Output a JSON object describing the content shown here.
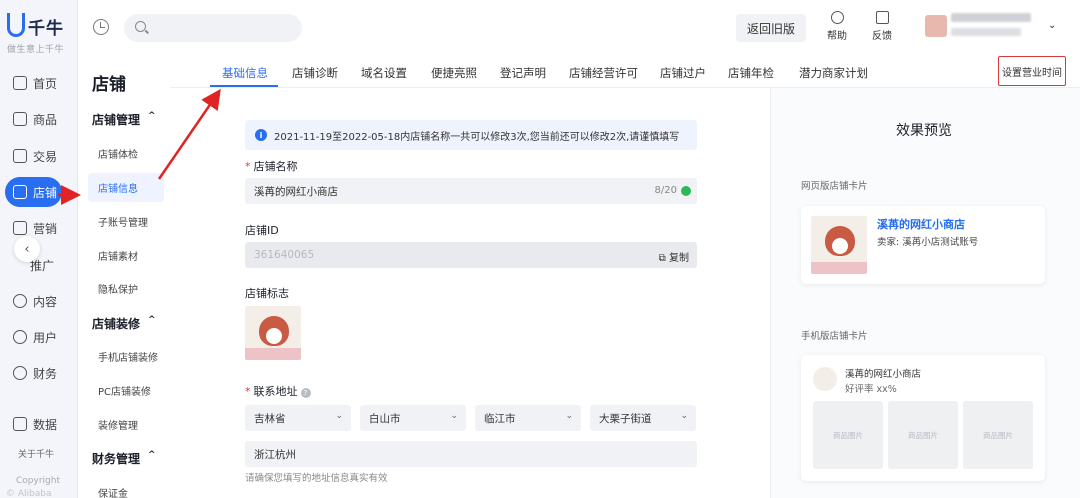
{
  "brand": {
    "name": "千牛",
    "tagline": "做生意上千牛"
  },
  "rail": {
    "items": [
      "首页",
      "商品",
      "交易",
      "店铺",
      "营销",
      "推广",
      "内容",
      "用户",
      "财务",
      "数据"
    ],
    "about": "关于千牛",
    "copyright": "Copyright",
    "copyright2": "© Alibaba Group"
  },
  "topbar": {
    "search_placeholder": "",
    "old_version": "返回旧版",
    "help": "帮助",
    "feedback": "反馈"
  },
  "sub": {
    "title": "店铺",
    "groups": [
      {
        "label": "店铺管理",
        "items": [
          "店铺体检",
          "店铺信息",
          "子账号管理",
          "店铺素材",
          "隐私保护"
        ]
      },
      {
        "label": "店铺装修",
        "items": [
          "手机店铺装修",
          "PC店铺装修",
          "装修管理"
        ]
      },
      {
        "label": "财务管理",
        "items": [
          "保证金"
        ]
      }
    ]
  },
  "tabs": [
    "基础信息",
    "店铺诊断",
    "域名设置",
    "便捷亮照",
    "登记声明",
    "店铺经营许可",
    "店铺过户",
    "店铺年检",
    "潜力商家计划"
  ],
  "hours_button": "设置营业时间",
  "notice": "2021-11-19至2022-05-18内店铺名称一共可以修改3次,您当前还可以修改2次,请谨慎填写",
  "form": {
    "name_label": "店铺名称",
    "name_value": "溪苒的网红小商店",
    "name_count": "8/20",
    "id_label": "店铺ID",
    "id_value": "361640065",
    "copy": "复制",
    "logo_label": "店铺标志",
    "address_label": "联系地址",
    "province": "吉林省",
    "city": "白山市",
    "district": "临江市",
    "street": "大栗子街道",
    "address_detail": "浙江杭州",
    "hint": "请确保您填写的地址信息真实有效"
  },
  "preview": {
    "title": "效果预览",
    "pc_label": "网页版店铺卡片",
    "pc_name": "溪苒的网红小商店",
    "pc_seller": "卖家: 溪苒小店测试账号",
    "mobile_label": "手机版店铺卡片",
    "m_name": "溪苒的网红小商店",
    "m_rate": "好评率 xx%",
    "product": "商品图片"
  }
}
